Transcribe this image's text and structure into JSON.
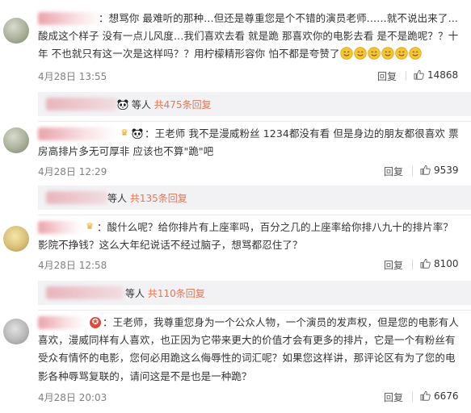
{
  "comments": [
    {
      "text": "：想骂你 最难听的那种…但还是尊重您是个不错的演员老师……就不说出来了…酸成这个样子 没有一点儿风度…我们喜欢去看 就是跪 那喜欢你的电影去看 是不是跪呢？？十年 不也就只有这一次是这样吗？？用柠檬精形容你 怕不都是夸赞了",
      "date": "4月28日 13:55",
      "reply_label": "回复",
      "likes": "14868",
      "replies_summary": {
        "suffix": "等人",
        "count": "共475条回复"
      }
    },
    {
      "text": "：王老师 我不是漫威粉丝 1234都没有看 但是身边的朋友都很喜欢  票房高排片多无可厚非   应该也不算\"跪\"吧",
      "date": "4月28日 12:29",
      "reply_label": "回复",
      "likes": "9539",
      "replies_summary": {
        "suffix": "等人",
        "count": "共135条回复"
      }
    },
    {
      "text": "：酸什么呢？给你排片有上座率吗，百分之几的上座率给你排八九十的排片率？影院不挣钱？这么大年纪说话不经过脑子，想骂都忍住了？",
      "date": "4月28日 12:58",
      "reply_label": "回复",
      "likes": "8100",
      "replies_summary": {
        "suffix": "等人",
        "count": "共110条回复"
      }
    },
    {
      "text": "：王老师，我尊重您身为一个公众人物，一个演员的发声权，但是您的电影有人喜欢，漫威同样有人喜欢，也正因为它带来更大的价值才会有更多的排片，它是一个有粉丝有受众有情怀的电影，您何必用跪这么侮辱性的词汇呢？如果您这样讲，那评论区有为了您的电影各种辱骂复联的，请问这是不是也是一种跪？",
      "date": "4月28日 20:03",
      "reply_label": "回复",
      "likes": "6676"
    }
  ],
  "colors": {
    "accent": "#eb7350",
    "reply_bg": "#f2f2f5",
    "date": "#808080"
  },
  "icons": {
    "like": "thumbs-up-icon",
    "panda": "panda-icon",
    "emoji": "smiley-emoji-icon",
    "badge": "crown-badge-icon"
  }
}
